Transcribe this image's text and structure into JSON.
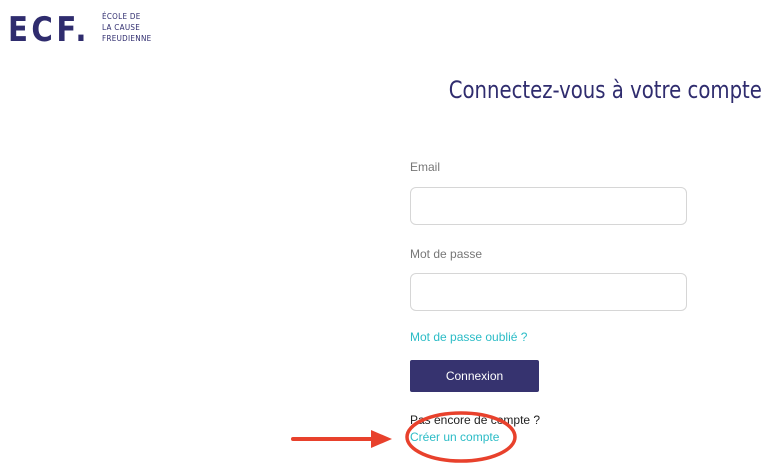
{
  "brand": {
    "logo_mark": "ECF.",
    "logo_lines": [
      "ÉCOLE DE",
      "LA CAUSE",
      "FREUDIENNE"
    ],
    "color": "#2f2c6e"
  },
  "login": {
    "title": "Connectez-vous à votre compte",
    "email_label": "Email",
    "email_value": "",
    "password_label": "Mot de passe",
    "password_value": "",
    "forgot_password_link": "Mot de passe oublié ?",
    "submit_label": "Connexion",
    "no_account_text": "Pas encore de compte ?",
    "create_account_link": "Créer un compte"
  },
  "colors": {
    "accent_link": "#2bbcc6",
    "button_bg": "#36336f",
    "annotation_red": "#e8412c"
  },
  "icons": {
    "annotation_arrow": "right-arrow-icon",
    "annotation_circle": "highlight-ellipse"
  }
}
